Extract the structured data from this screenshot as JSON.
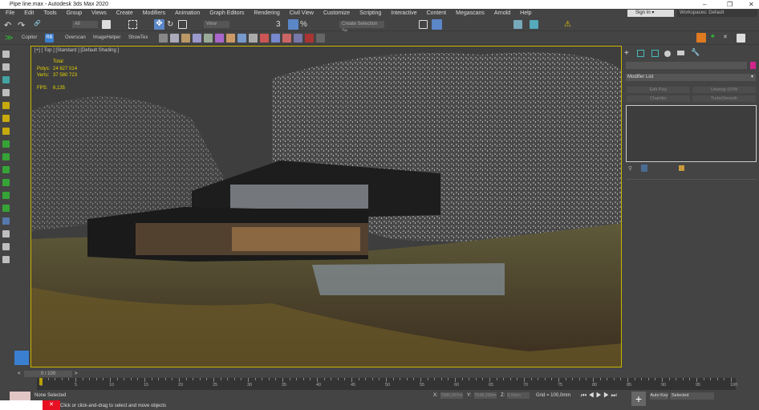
{
  "window": {
    "title": "Pipe line.max - Autodesk 3ds Max 2020",
    "minimize": "–",
    "restore": "❐",
    "close": "✕"
  },
  "menu": [
    "File",
    "Edit",
    "Tools",
    "Group",
    "Views",
    "Create",
    "Modifiers",
    "Animation",
    "Graph Editors",
    "Rendering",
    "Civil View",
    "Customize",
    "Scripting",
    "Interactive",
    "Content",
    "Megascans",
    "Arnold",
    "Help"
  ],
  "signin": "Sign In",
  "workspaces": {
    "label": "Workspaces:",
    "value": "Default"
  },
  "toolbar": {
    "filter": "All",
    "refcoord": "View",
    "selset": "Create Selection Se"
  },
  "toolbar2": {
    "copitor": "Copitor",
    "rb": "RB",
    "overscan": "Overscan",
    "imagehelper": "ImageHelper",
    "showtex": "ShowTex"
  },
  "viewport": {
    "label": "[+] [ Top ] [Standard ] [Default Shading ]",
    "stats": {
      "total": "Total",
      "polys_label": "Polys:",
      "polys": "24 627 014",
      "verts_label": "Verts:",
      "verts": "37 580 723",
      "fps_label": "FPS:",
      "fps": "6,135"
    }
  },
  "panel": {
    "modifier_list": "Modifier List",
    "buttons": [
      "Edit Poly",
      "Unwrap UVW",
      "Chamfer",
      "TurboSmooth"
    ],
    "color": "#d0268c"
  },
  "timeline": {
    "frame": "0 / 100",
    "prev": "<",
    "next": ">",
    "ticks": [
      "0",
      "5",
      "10",
      "15",
      "20",
      "25",
      "30",
      "35",
      "40",
      "45",
      "50",
      "55",
      "60",
      "65",
      "70",
      "75",
      "80",
      "85",
      "90",
      "95",
      "100"
    ]
  },
  "status": {
    "selection": "None Selected",
    "prompt": "Click or click-and-drag to select and move objects",
    "x_label": "X:",
    "x": "7586,597m",
    "y_label": "Y:",
    "y": "7548,299m",
    "z_label": "Z:",
    "z": "0,0mm",
    "grid": "Grid = 100,0mm",
    "autokey": "Auto Key",
    "keymode": "Selected"
  }
}
